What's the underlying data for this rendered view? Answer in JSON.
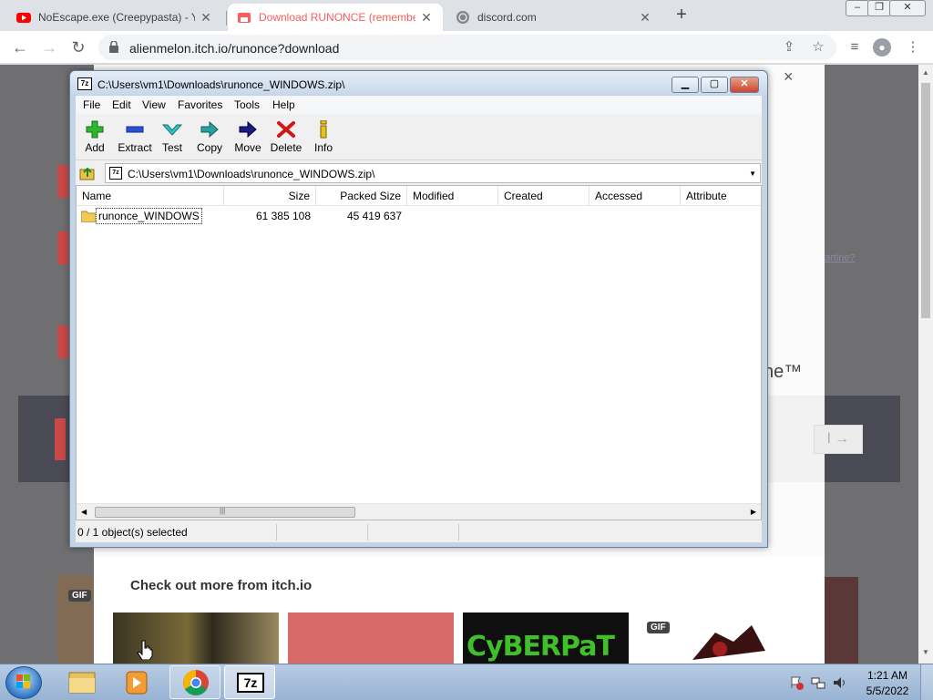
{
  "browser": {
    "tabs": [
      {
        "title": "NoEscape.exe (Creepypasta) - Yo",
        "active": false
      },
      {
        "title": "Download RUNONCE (remember",
        "active": true
      },
      {
        "title": "discord.com",
        "active": false
      }
    ],
    "new_tab": "+",
    "url": "alienmelon.itch.io/runonce?download",
    "window_controls": {
      "minimize": "–",
      "maximize": "❐",
      "close": "✕"
    }
  },
  "page": {
    "modal_close": "×",
    "trademark_fragment": "ne™",
    "link_fragment": "artine?",
    "arrow_button": "l →",
    "more_title": "Check out more from itch.io",
    "gif_badge": "GIF",
    "thumb_text": "CyBERPaT"
  },
  "zip": {
    "title": "C:\\Users\\vm1\\Downloads\\runonce_WINDOWS.zip\\",
    "menu": [
      "File",
      "Edit",
      "View",
      "Favorites",
      "Tools",
      "Help"
    ],
    "toolbar": [
      "Add",
      "Extract",
      "Test",
      "Copy",
      "Move",
      "Delete",
      "Info"
    ],
    "path": "C:\\Users\\vm1\\Downloads\\runonce_WINDOWS.zip\\",
    "columns": [
      "Name",
      "Size",
      "Packed Size",
      "Modified",
      "Created",
      "Accessed",
      "Attribute"
    ],
    "rows": [
      {
        "name": "runonce_WINDOWS",
        "size": "61 385 108",
        "packed": "45 419 637",
        "modified": "",
        "created": "",
        "accessed": "",
        "attr": ""
      }
    ],
    "status": "0 / 1 object(s) selected"
  },
  "taskbar": {
    "items": [
      "explorer",
      "media-player",
      "chrome",
      "7-zip"
    ],
    "seven_zip_label": "7z",
    "time": "1:21 AM",
    "date": "5/5/2022"
  }
}
